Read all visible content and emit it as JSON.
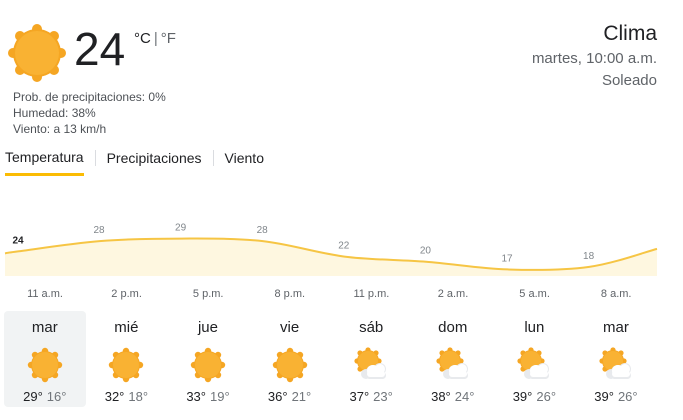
{
  "current": {
    "temperature": "24",
    "unit_c": "°C",
    "unit_f": "°F",
    "separator": "|",
    "icon": "sun-icon",
    "precipitation": "Prob. de precipitaciones: 0%",
    "humidity": "Humedad: 38%",
    "wind": "Viento: a 13 km/h"
  },
  "header": {
    "title": "Clima",
    "datetime": "martes, 10:00 a.m.",
    "condition": "Soleado"
  },
  "tabs": [
    {
      "label": "Temperatura",
      "active": true
    },
    {
      "label": "Precipitaciones",
      "active": false
    },
    {
      "label": "Viento",
      "active": false
    }
  ],
  "chart_data": {
    "type": "area",
    "values": [
      24,
      28,
      29,
      28,
      22,
      20,
      17,
      18
    ],
    "labels": [
      "24",
      "28",
      "29",
      "28",
      "22",
      "20",
      "17",
      "18"
    ],
    "times": [
      "11 a.m.",
      "2 p.m.",
      "5 p.m.",
      "8 p.m.",
      "11 p.m.",
      "2 a.m.",
      "5 a.m.",
      "8 a.m."
    ],
    "line_color": "#f6c544",
    "fill_color": "#fef7e0"
  },
  "forecast": [
    {
      "day": "mar",
      "icon": "sun-icon",
      "high": "29°",
      "low": "16°"
    },
    {
      "day": "mié",
      "icon": "sun-icon",
      "high": "32°",
      "low": "18°"
    },
    {
      "day": "jue",
      "icon": "sun-icon",
      "high": "33°",
      "low": "19°"
    },
    {
      "day": "vie",
      "icon": "sun-icon",
      "high": "36°",
      "low": "21°"
    },
    {
      "day": "sáb",
      "icon": "partly-cloudy-icon",
      "high": "37°",
      "low": "23°"
    },
    {
      "day": "dom",
      "icon": "partly-cloudy-icon",
      "high": "38°",
      "low": "24°"
    },
    {
      "day": "lun",
      "icon": "partly-cloudy-icon",
      "high": "39°",
      "low": "26°"
    },
    {
      "day": "mar",
      "icon": "partly-cloudy-icon",
      "high": "39°",
      "low": "26°"
    }
  ]
}
